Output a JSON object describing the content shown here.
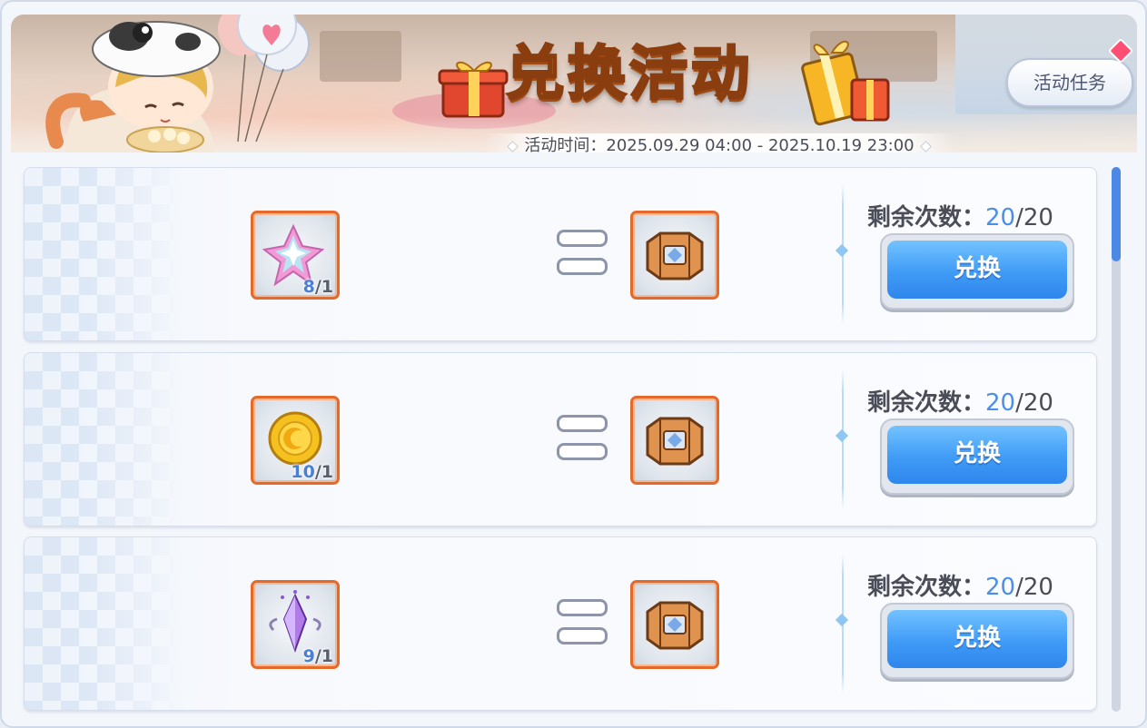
{
  "banner": {
    "title": "兑换活动",
    "time_label": "活动时间：",
    "time_range": "2025.09.29 04:00 - 2025.10.19 23:00",
    "task_button": "活动任务"
  },
  "exchanges": [
    {
      "cost_item": "star-crystal-icon",
      "cost_owned": "8",
      "cost_required": "/1",
      "reward_item": "treasure-chest-icon",
      "remain_label": "剩余次数：",
      "remain_current": "20",
      "remain_max": "/20",
      "button": "兑换"
    },
    {
      "cost_item": "gold-coin-icon",
      "cost_owned": "10",
      "cost_required": "/1",
      "reward_item": "treasure-chest-icon",
      "remain_label": "剩余次数：",
      "remain_current": "20",
      "remain_max": "/20",
      "button": "兑换"
    },
    {
      "cost_item": "purple-crystal-icon",
      "cost_owned": "9",
      "cost_required": "/1",
      "reward_item": "treasure-chest-icon",
      "remain_label": "剩余次数：",
      "remain_current": "20",
      "remain_max": "/20",
      "button": "兑换"
    }
  ],
  "colors": {
    "accent": "#3f9bf6",
    "slot_border": "#e36a2b",
    "count_highlight": "#4c8fe8"
  }
}
